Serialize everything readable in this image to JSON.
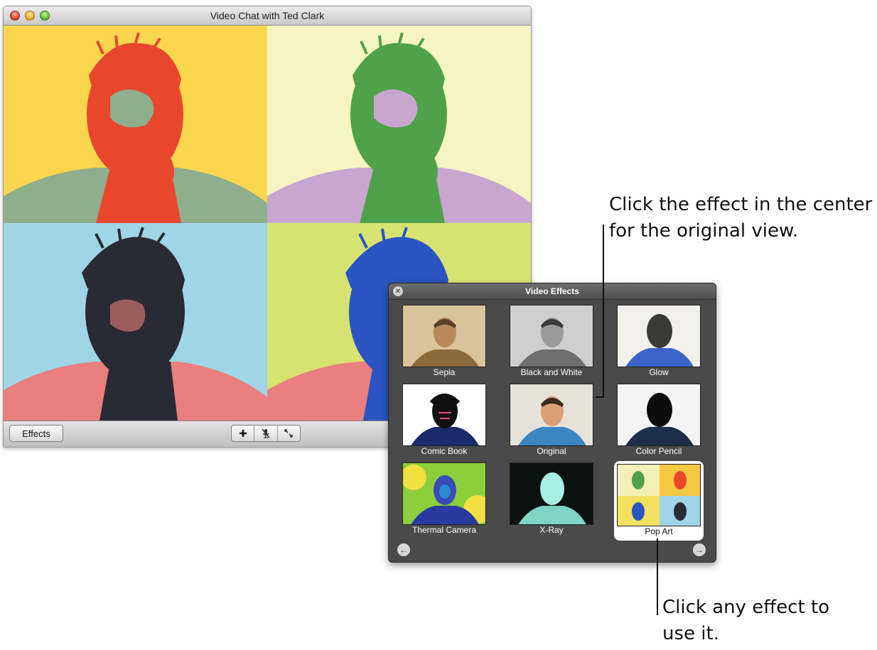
{
  "window": {
    "title": "Video Chat with Ted Clark"
  },
  "toolbar": {
    "effects_label": "Effects",
    "controls": [
      {
        "icon": "plus-icon"
      },
      {
        "icon": "mute-microphone-icon"
      },
      {
        "icon": "fullscreen-icon"
      }
    ]
  },
  "effects_panel": {
    "title": "Video Effects",
    "close_icon": "×",
    "prev_icon": "←",
    "next_icon": "→",
    "effects": [
      {
        "label": "Sepia"
      },
      {
        "label": "Black and White"
      },
      {
        "label": "Glow"
      },
      {
        "label": "Comic Book"
      },
      {
        "label": "Original"
      },
      {
        "label": "Color Pencil"
      },
      {
        "label": "Thermal Camera"
      },
      {
        "label": "X-Ray"
      },
      {
        "label": "Pop Art",
        "selected": true
      }
    ]
  },
  "callouts": {
    "center_line1": "Click the effect in the center",
    "center_line2": "for the original view.",
    "any_line1": "Click any effect to",
    "any_line2": "use it."
  }
}
